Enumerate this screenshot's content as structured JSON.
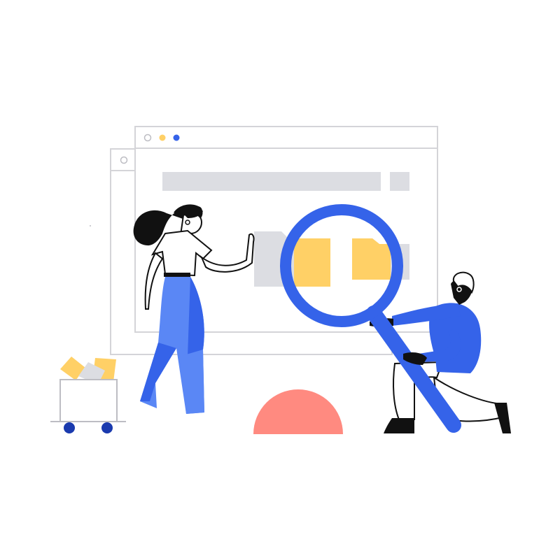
{
  "illustration": {
    "subject": "",
    "colors": {
      "blue": "#3563E9",
      "light_blue": "#5A87F5",
      "yellow": "#FFD066",
      "gray": "#DCDDE2",
      "outline": "#D4D4D8",
      "coral": "#FF8A80",
      "navy": "#1A3AAE",
      "black": "#111111"
    },
    "elements": {
      "back_window": {
        "icon": "browser-window-icon"
      },
      "front_window": {
        "icon": "browser-window-icon",
        "traffic_lights": [
          "gray-outline",
          "yellow",
          "blue"
        ]
      },
      "folders": {
        "icon": "folder-icon",
        "count": 2
      },
      "magnifier": {
        "icon": "magnifying-glass-icon"
      },
      "cart": {
        "icon": "cart-icon"
      },
      "half_circle": {
        "icon": "half-circle-shape"
      }
    }
  }
}
